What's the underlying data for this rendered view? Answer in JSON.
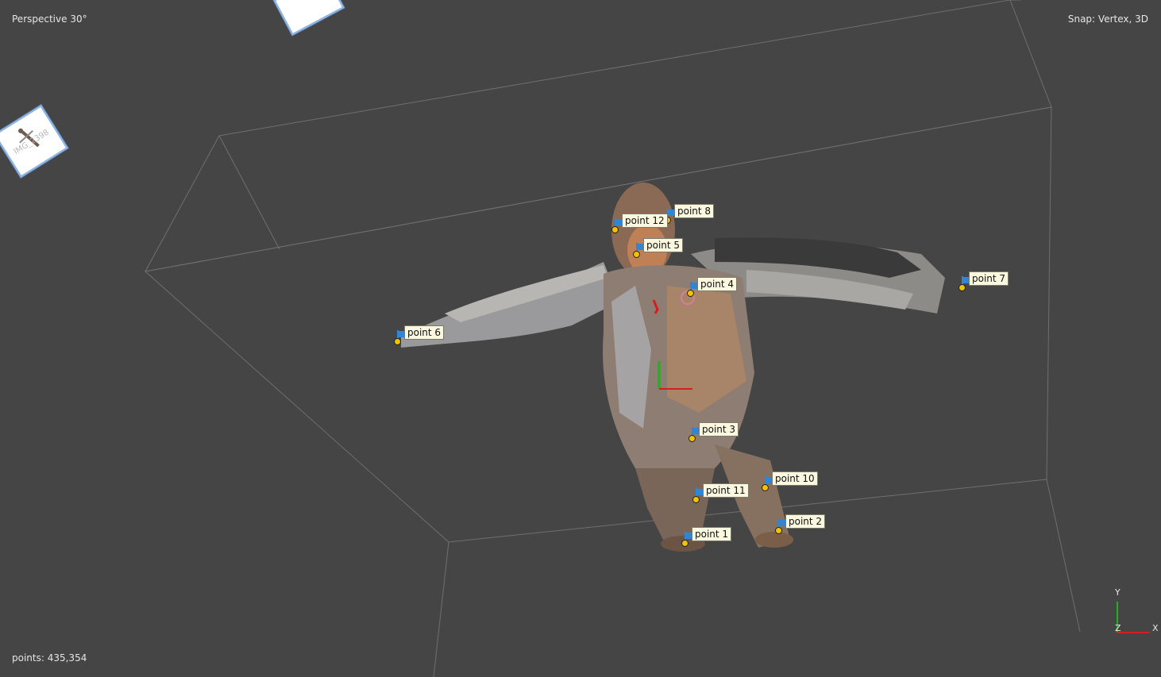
{
  "viewport": {
    "projection_label": "Perspective 30°",
    "snap_label": "Snap: Vertex, 3D",
    "points_label": "points: 435,354"
  },
  "cameras": [
    {
      "name": "camera-thumbnail-top",
      "label": ""
    },
    {
      "name": "camera-thumbnail-left",
      "label": "IMG_2398"
    }
  ],
  "markers": [
    {
      "label": "point 8"
    },
    {
      "label": "point 12"
    },
    {
      "label": "point 5"
    },
    {
      "label": "point 4"
    },
    {
      "label": "point 7"
    },
    {
      "label": "point 6"
    },
    {
      "label": "point 3"
    },
    {
      "label": "point 10"
    },
    {
      "label": "point 11"
    },
    {
      "label": "point 2"
    },
    {
      "label": "point 1"
    }
  ],
  "axis_gizmo": {
    "y_label": "Y",
    "z_label": "Z",
    "x_label": "X"
  },
  "colors": {
    "background": "#454545",
    "marker_flag": "#2f86d6",
    "marker_dot": "#f2c200",
    "marker_tag_bg": "#fbf8df",
    "axis_x": "#d22020",
    "axis_y": "#20b020"
  }
}
